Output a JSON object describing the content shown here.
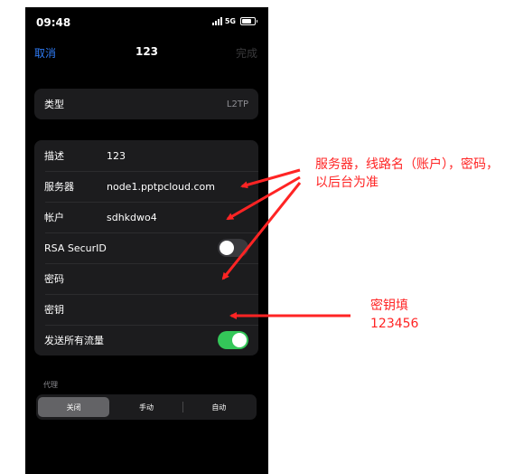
{
  "status_bar": {
    "time": "09:48",
    "network": "5G"
  },
  "nav": {
    "cancel": "取消",
    "title": "123",
    "done": "完成"
  },
  "type_row": {
    "label": "类型",
    "value": "L2TP"
  },
  "settings": [
    {
      "label": "描述",
      "value": "123"
    },
    {
      "label": "服务器",
      "value": "node1.pptpcloud.com"
    },
    {
      "label": "帐户",
      "value": "sdhkdwo4"
    },
    {
      "label": "RSA SecurID",
      "value": ""
    },
    {
      "label": "密码",
      "value": ""
    },
    {
      "label": "密钥",
      "value": ""
    },
    {
      "label": "发送所有流量",
      "value": ""
    }
  ],
  "toggles": {
    "rsa_securid": false,
    "send_all_traffic": true
  },
  "proxy": {
    "label": "代理",
    "options": [
      "关闭",
      "手动",
      "自动"
    ],
    "selected": "关闭"
  },
  "annotations": {
    "server_note": "服务器，线路名（账户），密码，以后台为准",
    "key_note_line1": "密钥填",
    "key_note_line2": "123456"
  },
  "colors": {
    "annotation": "#ff2424",
    "link": "#2f7cf6",
    "toggle_on": "#34c759"
  }
}
